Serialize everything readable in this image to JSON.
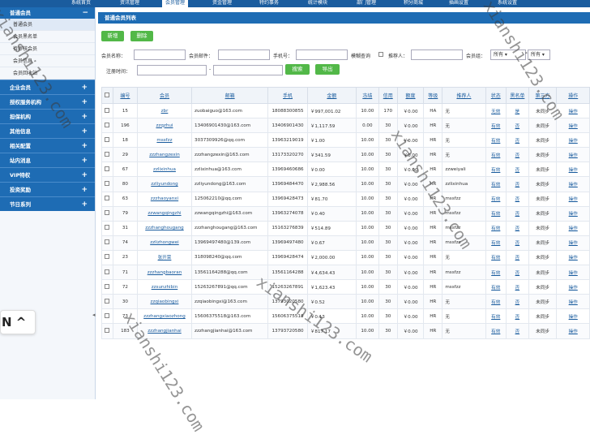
{
  "topnav": [
    "系统首页",
    "资讯管理",
    "会员管理",
    "资金管理",
    "特约事务",
    "统计模块",
    "部门管理",
    "积分商城",
    "插画设置",
    "系统设置"
  ],
  "sidebar": {
    "header": "普通会员",
    "subitems": [
      "普通会员",
      "会员黑名单",
      "待审核会员",
      "会员信息",
      "会员回收站"
    ],
    "groups": [
      "企业会员",
      "授权服务机构",
      "担保机构",
      "其他信息",
      "相关配置",
      "站内消息",
      "VIP特权",
      "投资奖励",
      "节日系列"
    ]
  },
  "panel_title": "普通会员列表",
  "buttons": {
    "add": "新增",
    "delete": "删除"
  },
  "filter": {
    "username_label": "会员名称：",
    "email_label": "会员邮件：",
    "phone_label": "手机号：",
    "fuzzy_label": "模糊查询",
    "referrer_label": "推荐人：",
    "group_label": "会员组：",
    "group_value": "所有 ▾",
    "status_value": "所有 ▾",
    "regtime_label": "注册时间：",
    "range_sep": "-",
    "search_button": "搜索",
    "export_button": "导出"
  },
  "table": {
    "headers": [
      "编号",
      "会员",
      "邮箱",
      "手机",
      "金额",
      "冻结",
      "信用",
      "额度",
      "等级",
      "推荐人",
      "状态",
      "黑名单",
      "第三方",
      "操作"
    ],
    "rows": [
      [
        "15",
        "zbr",
        "zuobaiguo@163.com",
        "18088300855",
        "￥997,001.02",
        "10.00",
        "170",
        "￥0.00",
        "HA",
        "无",
        "无效",
        "是",
        "未同步",
        "操作"
      ],
      [
        "196",
        "zzqzhui",
        "13406901430@163.com",
        "13406901430",
        "￥1,117.59",
        "0.00",
        "30",
        "￥0.00",
        "HR",
        "无",
        "有效",
        "否",
        "未同步",
        "操作"
      ],
      [
        "18",
        "mssfzz",
        "3037309926@qq.com",
        "13963219019",
        "￥1.00",
        "10.00",
        "30",
        "￥0.00",
        "HR",
        "无",
        "有效",
        "否",
        "未同步",
        "操作"
      ],
      [
        "29",
        "zzzhangzexin",
        "zzzhangzexin@163.com",
        "13173320270",
        "￥341.59",
        "10.00",
        "30",
        "￥0.00",
        "HR",
        "无",
        "有效",
        "否",
        "未同步",
        "操作"
      ],
      [
        "67",
        "zzlixinhua",
        "zzlixinhua@163.com",
        "13969460686",
        "￥0.00",
        "10.00",
        "30",
        "￥0.00",
        "HR",
        "zzweiyali",
        "有效",
        "否",
        "未同步",
        "操作"
      ],
      [
        "80",
        "zzliyundong",
        "zzliyundong@163.com",
        "13969484470",
        "￥2,988.56",
        "10.00",
        "30",
        "￥0.00",
        "HR",
        "zzlixinhua",
        "有效",
        "否",
        "未同步",
        "操作"
      ],
      [
        "63",
        "zzzhaoyanxi",
        "125062210@qq.com",
        "13969428473",
        "￥81.70",
        "10.00",
        "30",
        "￥0.00",
        "HR",
        "mssfzz",
        "有效",
        "否",
        "未同步",
        "操作"
      ],
      [
        "79",
        "zzwangqingzhi",
        "zzwangqingzhi@163.com",
        "13963274078",
        "￥0.40",
        "10.00",
        "30",
        "￥0.00",
        "HR",
        "mssfzz",
        "有效",
        "否",
        "未同步",
        "操作"
      ],
      [
        "31",
        "zzzhanghougang",
        "zzzhanghougang@163.com",
        "15163276839",
        "￥514.89",
        "10.00",
        "30",
        "￥0.00",
        "HR",
        "mssfzz",
        "有效",
        "否",
        "未同步",
        "操作"
      ],
      [
        "74",
        "zzlizhongwei",
        "13969497480@139.com",
        "13969497480",
        "￥0.67",
        "10.00",
        "30",
        "￥0.00",
        "HR",
        "mssfzz",
        "有效",
        "否",
        "未同步",
        "操作"
      ],
      [
        "23",
        "张开荣",
        "318098240@qq.com",
        "13969428474",
        "￥2,000.00",
        "10.00",
        "30",
        "￥0.00",
        "HR",
        "无",
        "有效",
        "否",
        "未同步",
        "操作"
      ],
      [
        "71",
        "zzzhangbaoran",
        "13561164288@qq.com",
        "13561164288",
        "￥4,634.43",
        "10.00",
        "30",
        "￥0.00",
        "HR",
        "mssfzz",
        "有效",
        "否",
        "未同步",
        "操作"
      ],
      [
        "72",
        "zzsunzhibin",
        "15263267891@qq.com",
        "15263267891",
        "￥1,623.43",
        "10.00",
        "30",
        "￥0.00",
        "HR",
        "mssfzz",
        "有效",
        "否",
        "未同步",
        "操作"
      ],
      [
        "30",
        "zzqiaobingxi",
        "zzqiaobingxi@163.com",
        "13793020580",
        "￥0.52",
        "10.00",
        "30",
        "￥0.00",
        "HR",
        "无",
        "有效",
        "否",
        "未同步",
        "操作"
      ],
      [
        "73",
        "zzzhangxiaozhong",
        "15606375518@163.com",
        "15606375518",
        "￥0.13",
        "10.00",
        "30",
        "￥0.00",
        "HR",
        "无",
        "有效",
        "否",
        "未同步",
        "操作"
      ],
      [
        "183",
        "zzzhangjianhai",
        "zzzhangjianhai@163.com",
        "13793720580",
        "￥817.17",
        "10.00",
        "30",
        "￥0.00",
        "HR",
        "无",
        "有效",
        "否",
        "未同步",
        "操作"
      ]
    ]
  },
  "lang_chip": "N ^",
  "watermark": "xianshi123.com"
}
